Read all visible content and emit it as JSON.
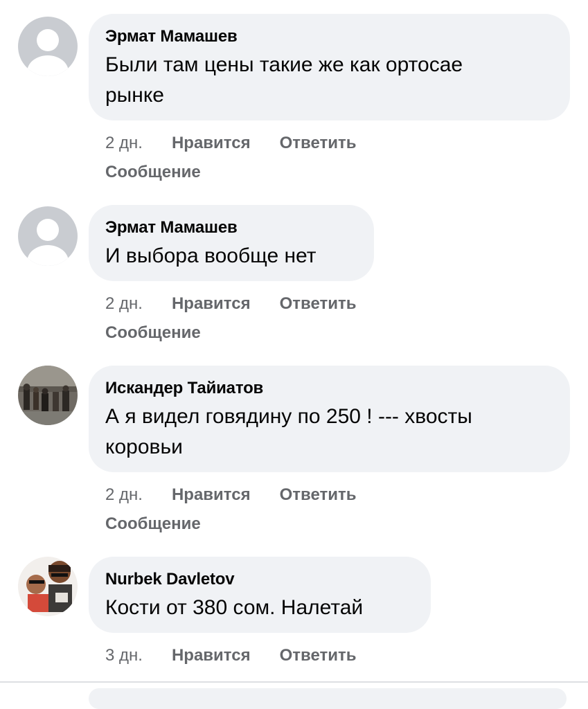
{
  "comments": [
    {
      "author": "Эрмат Мамашев",
      "text_lines": [
        "Были там цены такие же как ортосае",
        "рынке"
      ],
      "time": "2 дн.",
      "like": "Нравится",
      "reply": "Ответить",
      "message": "Сообщение",
      "avatar": "default-profile-icon"
    },
    {
      "author": "Эрмат Мамашев",
      "text_lines": [
        "И выбора вообще нет"
      ],
      "time": "2 дн.",
      "like": "Нравится",
      "reply": "Ответить",
      "message": "Сообщение",
      "avatar": "default-profile-icon"
    },
    {
      "author": "Искандер Тайиатов",
      "text_lines": [
        "А я видел говядину по 250 ! --- хвосты",
        "коровьи"
      ],
      "time": "2 дн.",
      "like": "Нравится",
      "reply": "Ответить",
      "message": "Сообщение",
      "avatar": "user-photo"
    },
    {
      "author": "Nurbek Davletov",
      "text_lines": [
        "Кости от 380 сом. Налетай"
      ],
      "time": "3 дн.",
      "like": "Нравится",
      "reply": "Ответить",
      "avatar": "user-photo"
    }
  ],
  "colors": {
    "bubble": "#f0f2f5",
    "meta_text": "#65676b",
    "text": "#050505"
  }
}
